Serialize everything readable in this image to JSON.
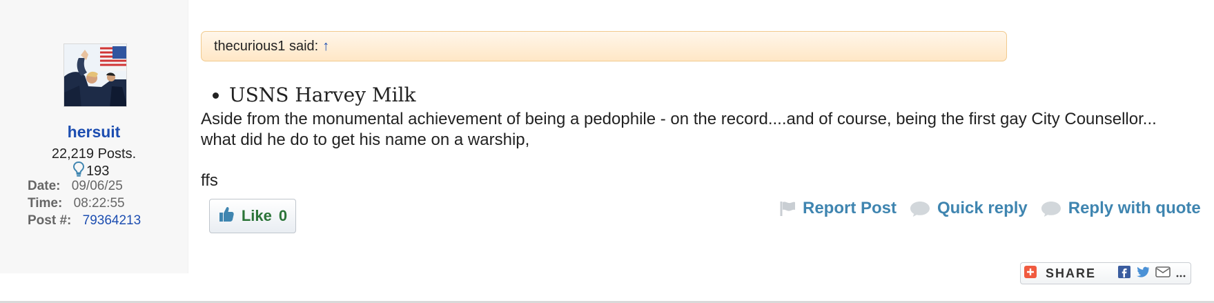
{
  "user": {
    "username": "hersuit",
    "posts": "22,219 Posts.",
    "reputation": "193",
    "date_label": "Date:",
    "date_value": "09/06/25",
    "time_label": "Time:",
    "time_value": "08:22:55",
    "post_label": "Post #:",
    "post_value": "79364213"
  },
  "post": {
    "quote_author": "thecurious1 said:",
    "quote_arrow": "↑",
    "bullet_item": "USNS Harvey Milk",
    "body_text": "Aside from the monumental achievement of being a pedophile - on the record....and of course, being the first gay City Counsellor... what did he do to get his name on a warship,",
    "closing": "ffs"
  },
  "like": {
    "label": "Like",
    "count": "0"
  },
  "actions": {
    "report": "Report Post",
    "quick_reply": "Quick reply",
    "reply_with_quote": "Reply with quote"
  },
  "share": {
    "label": "SHARE"
  },
  "icons": {
    "avatar": "avatar-photo",
    "reputation": "lightbulb-icon",
    "like": "thumbs-up-icon",
    "report": "flag-icon",
    "quick_reply": "speech-bubble-icon",
    "reply_with_quote": "speech-bubble-icon",
    "share": "share-plus-icon",
    "facebook": "facebook-icon",
    "twitter": "twitter-icon",
    "email": "email-icon",
    "more": "more-icon"
  },
  "colors": {
    "username": "#1d4eb1",
    "link": "#3f85b0",
    "like": "#2b7438",
    "quote_background": "#ffe7c6"
  }
}
